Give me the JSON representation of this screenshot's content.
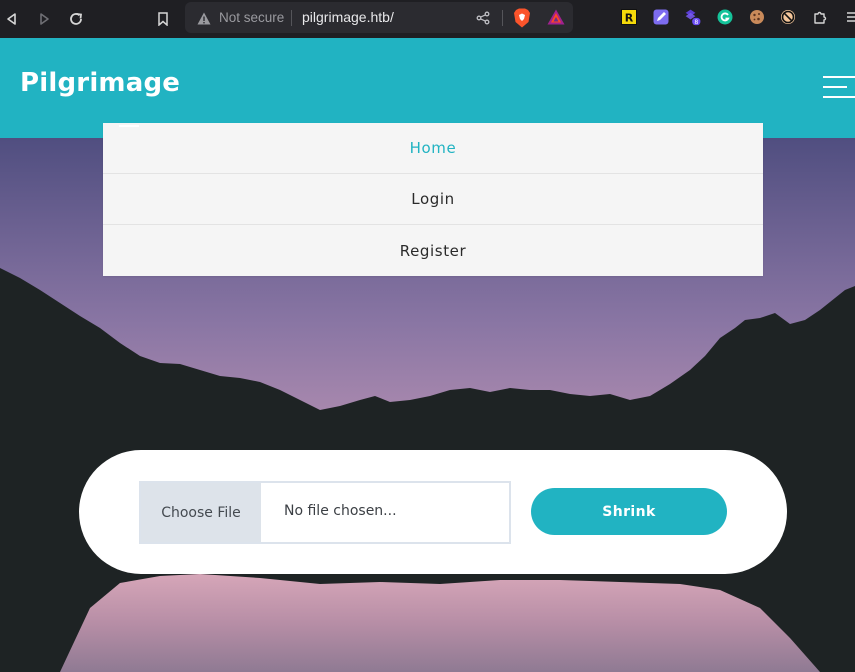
{
  "browser": {
    "security_label": "Not secure",
    "url": "pilgrimage.htb/",
    "extensions": [
      {
        "name": "reader-extension-icon",
        "color": "#f5d90a",
        "glyph": "R"
      },
      {
        "name": "notes-extension-icon",
        "color": "#7d6cf0",
        "glyph": "✎"
      },
      {
        "name": "layers-extension-icon",
        "color": "#6a4cf5",
        "glyph": "◆",
        "badge": "8"
      },
      {
        "name": "grammarly-extension-icon",
        "color": "#15c39a",
        "glyph": "G"
      },
      {
        "name": "cookie-extension-icon",
        "color": "#c98a5a",
        "glyph": "●"
      },
      {
        "name": "blocker-extension-icon",
        "color": "#e07b39",
        "glyph": "⊘"
      },
      {
        "name": "puzzle-extensions-icon",
        "color": "#d6d6d6",
        "glyph": "✚"
      }
    ]
  },
  "site": {
    "brand": "Pilgrimage",
    "accent_color": "#21b3c2"
  },
  "menu": {
    "items": [
      {
        "label": "Home",
        "active": true
      },
      {
        "label": "Login",
        "active": false
      },
      {
        "label": "Register",
        "active": false
      }
    ]
  },
  "upload": {
    "choose_label": "Choose File",
    "file_status": "No file chosen...",
    "submit_label": "Shrink"
  }
}
